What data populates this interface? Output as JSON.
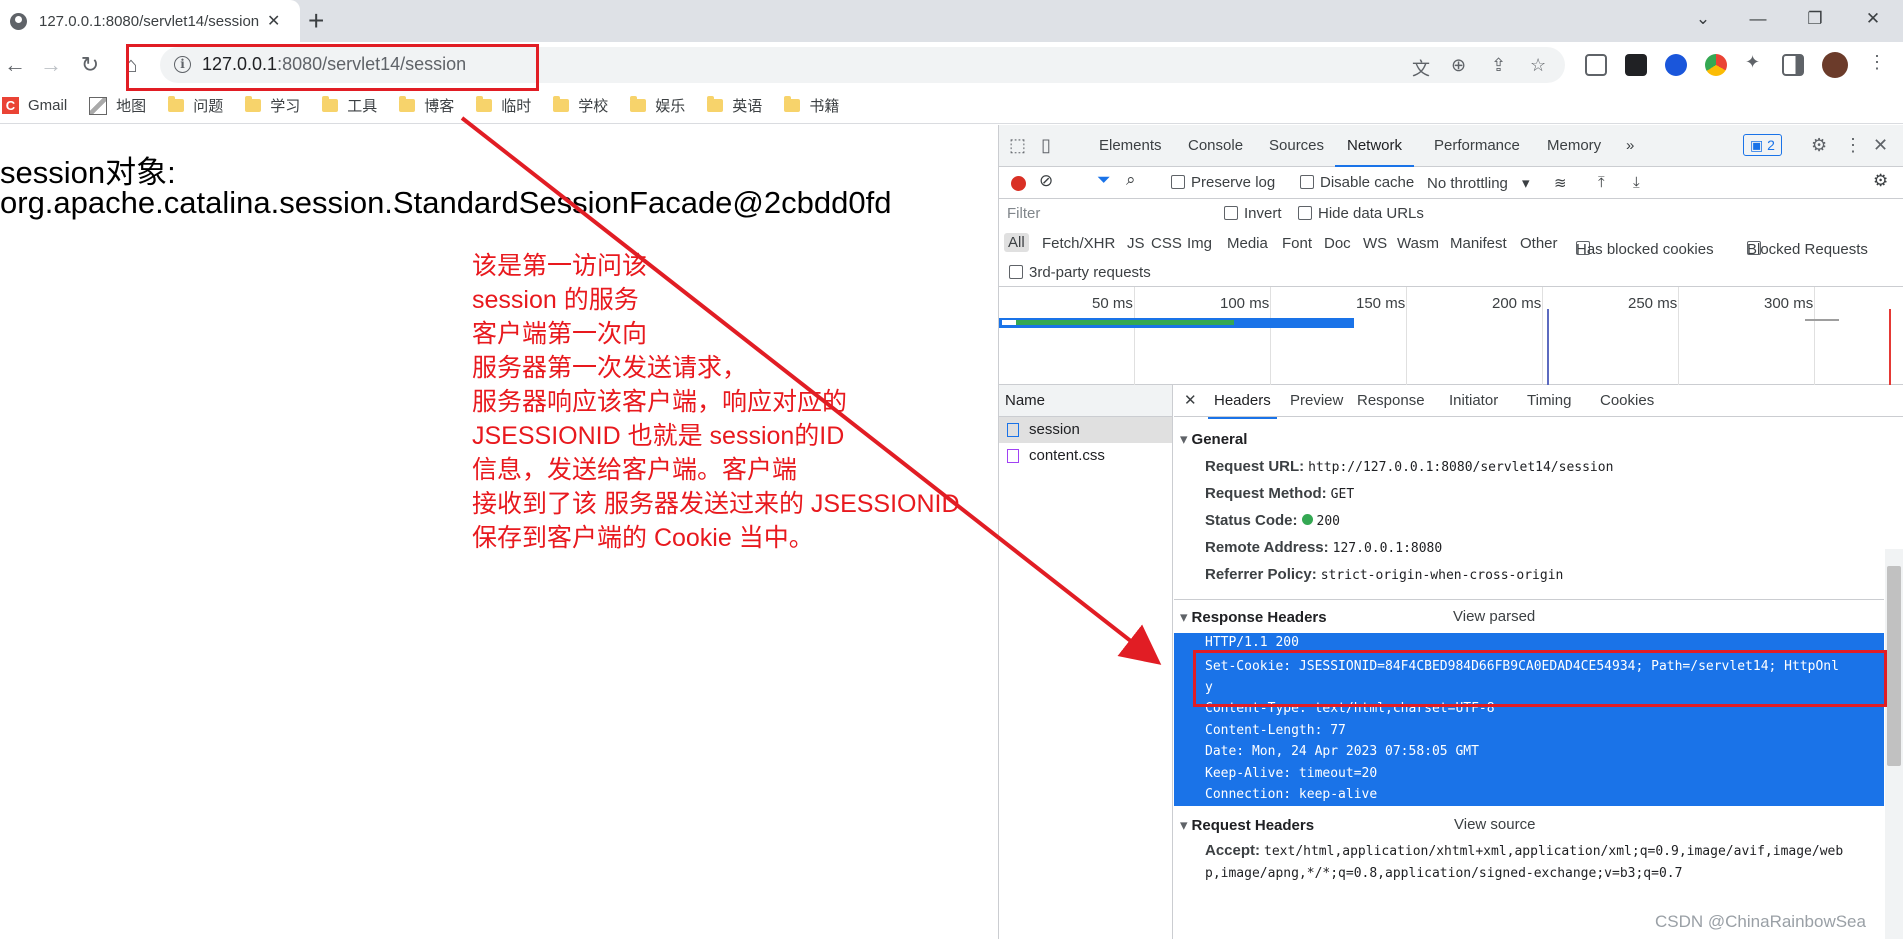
{
  "browser": {
    "tab_title": "127.0.0.1:8080/servlet14/session",
    "tab_close": "✕",
    "new_tab": "+",
    "url_host": "127.0.0.1",
    "url_rest": ":8080/servlet14/session",
    "window_controls": [
      "⌄",
      "—",
      "❐",
      "✕"
    ]
  },
  "bookmarks": [
    {
      "label": "Gmail",
      "icon": "gmail-icon"
    },
    {
      "label": "地图",
      "icon": "map-icon"
    },
    {
      "label": "问题",
      "icon": "folder-icon"
    },
    {
      "label": "学习",
      "icon": "folder-icon"
    },
    {
      "label": "工具",
      "icon": "folder-icon"
    },
    {
      "label": "博客",
      "icon": "folder-icon"
    },
    {
      "label": "临时",
      "icon": "folder-icon"
    },
    {
      "label": "学校",
      "icon": "folder-icon"
    },
    {
      "label": "娱乐",
      "icon": "folder-icon"
    },
    {
      "label": "英语",
      "icon": "folder-icon"
    },
    {
      "label": "书籍",
      "icon": "folder-icon"
    }
  ],
  "page": {
    "line1": "session对象:",
    "line2": "org.apache.catalina.session.StandardSessionFacade@2cbdd0fd",
    "annotation": [
      "该是第一访问该",
      "session 的服务",
      "客户端第一次向",
      "服务器第一次发送请求，",
      "服务器响应该客户端，响应对应的",
      "JSESSIONID 也就是 session的ID",
      "信息，发送给客户端。客户端",
      "接收到了该 服务器发送过来的 JSESSIONID",
      "保存到客户端的 Cookie 当中。"
    ],
    "annotation_color": "#e8191e"
  },
  "devtools": {
    "tabs": [
      "Elements",
      "Console",
      "Sources",
      "Network",
      "Performance",
      "Memory"
    ],
    "active_tab": "Network",
    "more_tabs": "»",
    "issues_badge": "2",
    "toolbar": {
      "preserve_log": "Preserve log",
      "disable_cache": "Disable cache",
      "throttling": "No throttling"
    },
    "filter_placeholder": "Filter",
    "invert": "Invert",
    "hide_data_urls": "Hide data URLs",
    "types": [
      "All",
      "Fetch/XHR",
      "JS",
      "CSS",
      "Img",
      "Media",
      "Font",
      "Doc",
      "WS",
      "Wasm",
      "Manifest",
      "Other"
    ],
    "has_blocked_cookies": "Has blocked cookies",
    "blocked_requests": "Blocked Requests",
    "third_party": "3rd-party requests",
    "timeline_ticks": [
      "50 ms",
      "100 ms",
      "150 ms",
      "200 ms",
      "250 ms",
      "300 ms"
    ],
    "names_header": "Name",
    "requests": [
      "session",
      "content.css"
    ],
    "detail_tabs": [
      "Headers",
      "Preview",
      "Response",
      "Initiator",
      "Timing",
      "Cookies"
    ],
    "active_detail_tab": "Headers",
    "general": {
      "title": "General",
      "rows": [
        {
          "k": "Request URL:",
          "v": "http://127.0.0.1:8080/servlet14/session"
        },
        {
          "k": "Request Method:",
          "v": "GET"
        },
        {
          "k": "Status Code:",
          "v": "200"
        },
        {
          "k": "Remote Address:",
          "v": "127.0.0.1:8080"
        },
        {
          "k": "Referrer Policy:",
          "v": "strict-origin-when-cross-origin"
        }
      ]
    },
    "response_headers": {
      "title": "Response Headers",
      "link": "View parsed",
      "lines": [
        "HTTP/1.1 200",
        "Set-Cookie: JSESSIONID=84F4CBED984D66FB9CA0EDAD4CE54934; Path=/servlet14; HttpOnl",
        "y",
        "Content-Type: text/html;charset=UTF-8",
        "Content-Length: 77",
        "Date: Mon, 24 Apr 2023 07:58:05 GMT",
        "Keep-Alive: timeout=20",
        "Connection: keep-alive"
      ]
    },
    "request_headers": {
      "title": "Request Headers",
      "link": "View source",
      "accept_key": "Accept:",
      "accept_line1": "text/html,application/xhtml+xml,application/xml;q=0.9,image/avif,image/web",
      "accept_line2": "p,image/apng,*/*;q=0.8,application/signed-exchange;v=b3;q=0.7"
    }
  },
  "watermark": "CSDN @ChinaRainbowSea",
  "colors": {
    "highlight": "#1a73e8",
    "annotation_red": "#e11d24"
  }
}
